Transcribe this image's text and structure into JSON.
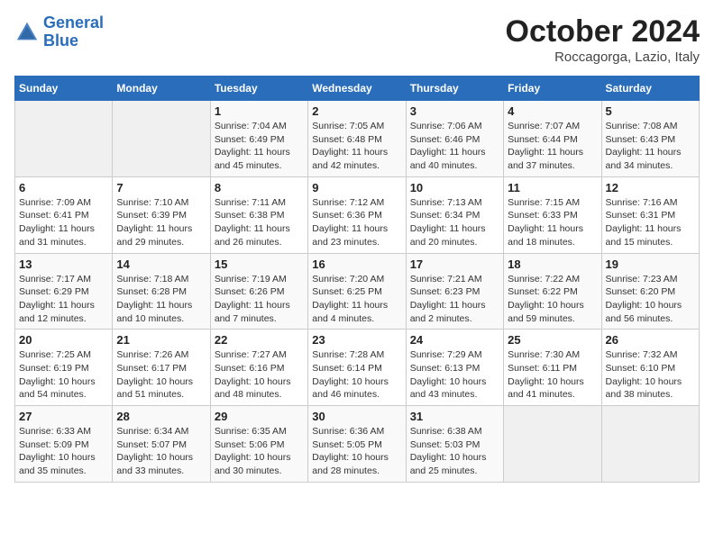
{
  "header": {
    "logo_line1": "General",
    "logo_line2": "Blue",
    "month": "October 2024",
    "location": "Roccagorga, Lazio, Italy"
  },
  "weekdays": [
    "Sunday",
    "Monday",
    "Tuesday",
    "Wednesday",
    "Thursday",
    "Friday",
    "Saturday"
  ],
  "weeks": [
    [
      {
        "day": "",
        "info": ""
      },
      {
        "day": "",
        "info": ""
      },
      {
        "day": "1",
        "info": "Sunrise: 7:04 AM\nSunset: 6:49 PM\nDaylight: 11 hours and 45 minutes."
      },
      {
        "day": "2",
        "info": "Sunrise: 7:05 AM\nSunset: 6:48 PM\nDaylight: 11 hours and 42 minutes."
      },
      {
        "day": "3",
        "info": "Sunrise: 7:06 AM\nSunset: 6:46 PM\nDaylight: 11 hours and 40 minutes."
      },
      {
        "day": "4",
        "info": "Sunrise: 7:07 AM\nSunset: 6:44 PM\nDaylight: 11 hours and 37 minutes."
      },
      {
        "day": "5",
        "info": "Sunrise: 7:08 AM\nSunset: 6:43 PM\nDaylight: 11 hours and 34 minutes."
      }
    ],
    [
      {
        "day": "6",
        "info": "Sunrise: 7:09 AM\nSunset: 6:41 PM\nDaylight: 11 hours and 31 minutes."
      },
      {
        "day": "7",
        "info": "Sunrise: 7:10 AM\nSunset: 6:39 PM\nDaylight: 11 hours and 29 minutes."
      },
      {
        "day": "8",
        "info": "Sunrise: 7:11 AM\nSunset: 6:38 PM\nDaylight: 11 hours and 26 minutes."
      },
      {
        "day": "9",
        "info": "Sunrise: 7:12 AM\nSunset: 6:36 PM\nDaylight: 11 hours and 23 minutes."
      },
      {
        "day": "10",
        "info": "Sunrise: 7:13 AM\nSunset: 6:34 PM\nDaylight: 11 hours and 20 minutes."
      },
      {
        "day": "11",
        "info": "Sunrise: 7:15 AM\nSunset: 6:33 PM\nDaylight: 11 hours and 18 minutes."
      },
      {
        "day": "12",
        "info": "Sunrise: 7:16 AM\nSunset: 6:31 PM\nDaylight: 11 hours and 15 minutes."
      }
    ],
    [
      {
        "day": "13",
        "info": "Sunrise: 7:17 AM\nSunset: 6:29 PM\nDaylight: 11 hours and 12 minutes."
      },
      {
        "day": "14",
        "info": "Sunrise: 7:18 AM\nSunset: 6:28 PM\nDaylight: 11 hours and 10 minutes."
      },
      {
        "day": "15",
        "info": "Sunrise: 7:19 AM\nSunset: 6:26 PM\nDaylight: 11 hours and 7 minutes."
      },
      {
        "day": "16",
        "info": "Sunrise: 7:20 AM\nSunset: 6:25 PM\nDaylight: 11 hours and 4 minutes."
      },
      {
        "day": "17",
        "info": "Sunrise: 7:21 AM\nSunset: 6:23 PM\nDaylight: 11 hours and 2 minutes."
      },
      {
        "day": "18",
        "info": "Sunrise: 7:22 AM\nSunset: 6:22 PM\nDaylight: 10 hours and 59 minutes."
      },
      {
        "day": "19",
        "info": "Sunrise: 7:23 AM\nSunset: 6:20 PM\nDaylight: 10 hours and 56 minutes."
      }
    ],
    [
      {
        "day": "20",
        "info": "Sunrise: 7:25 AM\nSunset: 6:19 PM\nDaylight: 10 hours and 54 minutes."
      },
      {
        "day": "21",
        "info": "Sunrise: 7:26 AM\nSunset: 6:17 PM\nDaylight: 10 hours and 51 minutes."
      },
      {
        "day": "22",
        "info": "Sunrise: 7:27 AM\nSunset: 6:16 PM\nDaylight: 10 hours and 48 minutes."
      },
      {
        "day": "23",
        "info": "Sunrise: 7:28 AM\nSunset: 6:14 PM\nDaylight: 10 hours and 46 minutes."
      },
      {
        "day": "24",
        "info": "Sunrise: 7:29 AM\nSunset: 6:13 PM\nDaylight: 10 hours and 43 minutes."
      },
      {
        "day": "25",
        "info": "Sunrise: 7:30 AM\nSunset: 6:11 PM\nDaylight: 10 hours and 41 minutes."
      },
      {
        "day": "26",
        "info": "Sunrise: 7:32 AM\nSunset: 6:10 PM\nDaylight: 10 hours and 38 minutes."
      }
    ],
    [
      {
        "day": "27",
        "info": "Sunrise: 6:33 AM\nSunset: 5:09 PM\nDaylight: 10 hours and 35 minutes."
      },
      {
        "day": "28",
        "info": "Sunrise: 6:34 AM\nSunset: 5:07 PM\nDaylight: 10 hours and 33 minutes."
      },
      {
        "day": "29",
        "info": "Sunrise: 6:35 AM\nSunset: 5:06 PM\nDaylight: 10 hours and 30 minutes."
      },
      {
        "day": "30",
        "info": "Sunrise: 6:36 AM\nSunset: 5:05 PM\nDaylight: 10 hours and 28 minutes."
      },
      {
        "day": "31",
        "info": "Sunrise: 6:38 AM\nSunset: 5:03 PM\nDaylight: 10 hours and 25 minutes."
      },
      {
        "day": "",
        "info": ""
      },
      {
        "day": "",
        "info": ""
      }
    ]
  ]
}
